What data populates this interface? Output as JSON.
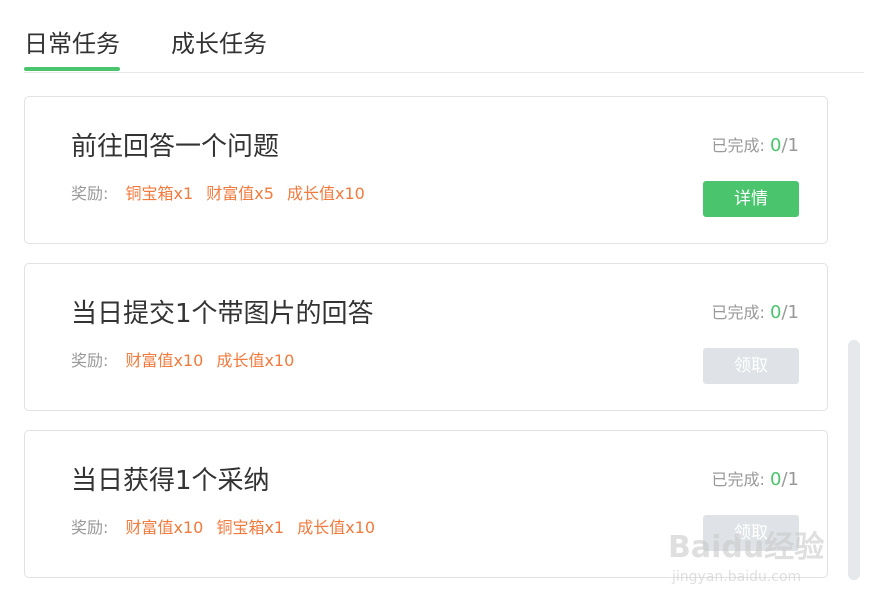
{
  "tabs": [
    {
      "label": "日常任务",
      "active": true
    },
    {
      "label": "成长任务",
      "active": false
    }
  ],
  "accent_color": "#4ac56e",
  "reward_color": "#f27a3d",
  "tasks": [
    {
      "title": "前往回答一个问题",
      "reward_label": "奖励:",
      "rewards": [
        "铜宝箱x1",
        "财富值x5",
        "成长值x10"
      ],
      "progress_label": "已完成:",
      "progress_done": "0",
      "progress_total": "/1",
      "button_label": "详情",
      "button_enabled": true
    },
    {
      "title": "当日提交1个带图片的回答",
      "reward_label": "奖励:",
      "rewards": [
        "财富值x10",
        "成长值x10"
      ],
      "progress_label": "已完成:",
      "progress_done": "0",
      "progress_total": "/1",
      "button_label": "领取",
      "button_enabled": false
    },
    {
      "title": "当日获得1个采纳",
      "reward_label": "奖励:",
      "rewards": [
        "财富值x10",
        "铜宝箱x1",
        "成长值x10"
      ],
      "progress_label": "已完成:",
      "progress_done": "0",
      "progress_total": "/1",
      "button_label": "领取",
      "button_enabled": false
    }
  ],
  "watermark": {
    "main": "Baidu经验",
    "sub": "jingyan.baidu.com"
  }
}
